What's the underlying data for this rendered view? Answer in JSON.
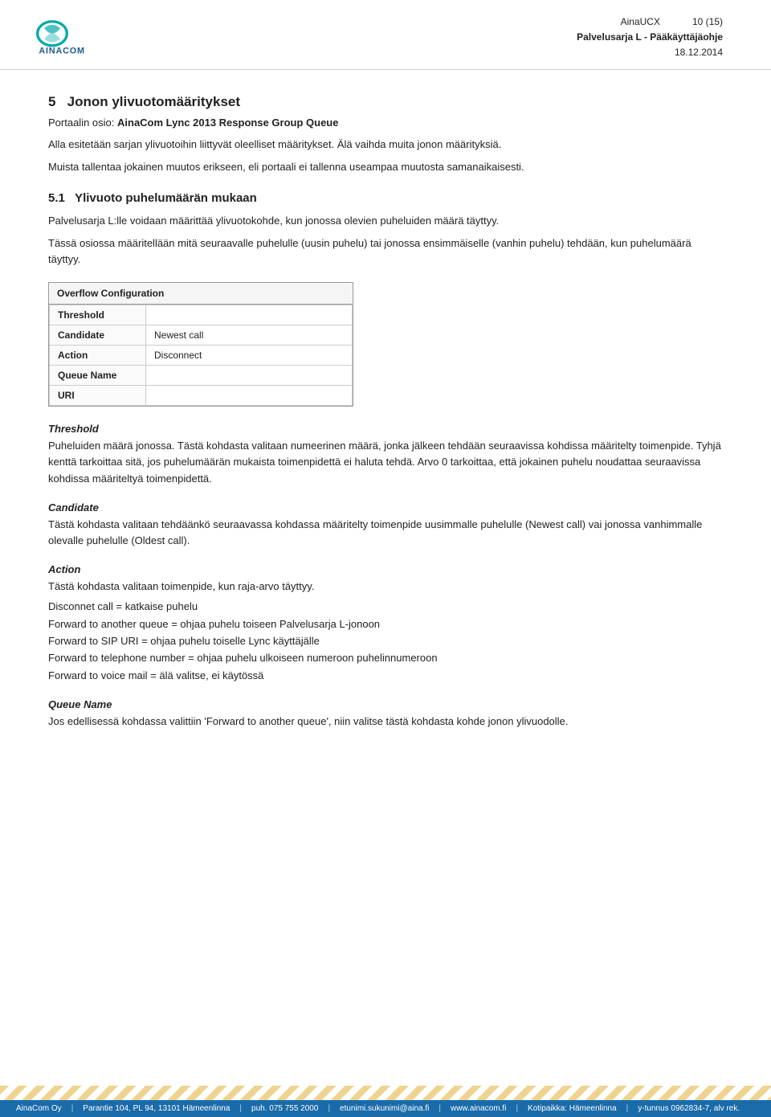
{
  "header": {
    "company": "AinaUCX",
    "page_info": "10 (15)",
    "doc_title": "Palvelusarja L - Pääkäyttäjäohje",
    "date": "18.12.2014"
  },
  "section5": {
    "number": "5",
    "title": "Jonon ylivuotomääritykset",
    "portal_line_prefix": "Portaalin osio: ",
    "portal_line_bold": "AinaCom Lync 2013 Response Group Queue",
    "para1": "Alla esitetään sarjan ylivuotoihin liittyvät oleelliset määritykset. Älä vaihda muita jonon määrityksiä.",
    "para2": "Muista tallentaa jokainen muutos erikseen, eli portaali ei tallenna useampaa muutosta samanaikaisesti."
  },
  "section51": {
    "number": "5.1",
    "title": "Ylivuoto puhelumäärän mukaan",
    "para1": "Palvelusarja L:lle voidaan määrittää ylivuotokohde, kun jonossa olevien puheluiden määrä täyttyy.",
    "para2": "Tässä osiossa määritellään mitä seuraavalle puhelulle (uusin puhelu) tai jonossa ensimmäiselle (vanhin puhelu) tehdään, kun puhelumäärä täyttyy."
  },
  "overflow_config": {
    "box_title": "Overflow Configuration",
    "rows": [
      {
        "label": "Threshold",
        "value": ""
      },
      {
        "label": "Candidate",
        "value": "Newest call"
      },
      {
        "label": "Action",
        "value": "Disconnect"
      },
      {
        "label": "Queue Name",
        "value": ""
      },
      {
        "label": "URI",
        "value": ""
      }
    ]
  },
  "descriptions": {
    "threshold": {
      "label": "Threshold",
      "text": "Puheluiden määrä jonossa. Tästä kohdasta valitaan numeerinen määrä, jonka jälkeen tehdään seuraavissa kohdissa määritelty toimenpide. Tyhjä kenttä tarkoittaa sitä, jos puhelumäärän mukaista toimenpidettä ei haluta tehdä. Arvo 0 tarkoittaa, että jokainen puhelu noudattaa seuraavissa kohdissa määriteltyä toimenpidettä."
    },
    "candidate": {
      "label": "Candidate",
      "text": "Tästä kohdasta valitaan tehdäänkö seuraavassa kohdassa määritelty toimenpide uusimmalle puhelulle (Newest call) vai jonossa vanhimmalle olevalle puhelulle (Oldest call)."
    },
    "action": {
      "label": "Action",
      "text": "Tästä kohdasta valitaan toimenpide, kun raja-arvo täyttyy."
    },
    "action_list": [
      "Disconnet call = katkaise puhelu",
      "Forward to another queue = ohjaa puhelu toiseen Palvelusarja L-jonoon",
      "Forward to SIP URI = ohjaa puhelu toiselle Lync käyttäjälle",
      "Forward to telephone number = ohjaa puhelu ulkoiseen numeroon puhelinnumeroon",
      "Forward to voice mail = älä valitse, ei käytössä"
    ],
    "queue_name": {
      "label": "Queue Name",
      "text": "Jos edellisessä kohdassa valittiin 'Forward to another queue', niin valitse tästä kohdasta kohde jonon ylivuodolle."
    }
  },
  "footer": {
    "company": "AinaCom Oy",
    "address": "Parantie 104, PL 94, 13101 Hämeenlinna",
    "phone": "puh. 075 755 2000",
    "email": "etunimi.sukunimi@aina.fi",
    "website": "www.ainacom.fi",
    "kotipaikka": "Kotipaikka: Hämeenlinna",
    "ytunnus": "y-tunnus 0962834-7, alv rek."
  }
}
